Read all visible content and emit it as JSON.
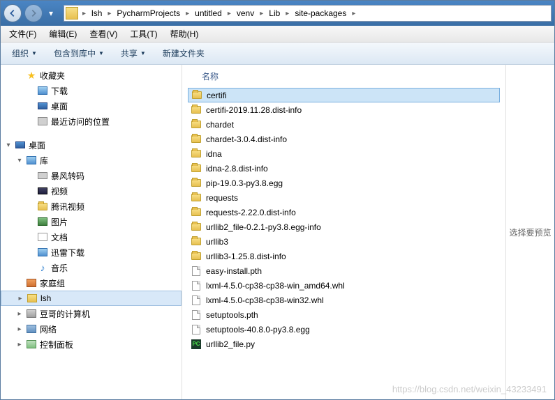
{
  "breadcrumb": [
    "lsh",
    "PycharmProjects",
    "untitled",
    "venv",
    "Lib",
    "site-packages"
  ],
  "menus": [
    {
      "label": "文件(F)"
    },
    {
      "label": "编辑(E)"
    },
    {
      "label": "查看(V)"
    },
    {
      "label": "工具(T)"
    },
    {
      "label": "帮助(H)"
    }
  ],
  "toolbar": [
    {
      "label": "组织",
      "dropdown": true
    },
    {
      "label": "包含到库中",
      "dropdown": true
    },
    {
      "label": "共享",
      "dropdown": true
    },
    {
      "label": "新建文件夹",
      "dropdown": false
    }
  ],
  "tree": [
    {
      "indent": 1,
      "toggle": "",
      "icon": "star",
      "label": "收藏夹"
    },
    {
      "indent": 2,
      "toggle": "",
      "icon": "down",
      "label": "下载"
    },
    {
      "indent": 2,
      "toggle": "",
      "icon": "desktop",
      "label": "桌面"
    },
    {
      "indent": 2,
      "toggle": "",
      "icon": "recent",
      "label": "最近访问的位置"
    },
    {
      "indent": 0,
      "toggle": "",
      "icon": "",
      "label": ""
    },
    {
      "indent": 0,
      "toggle": "▾",
      "icon": "desktop",
      "label": "桌面"
    },
    {
      "indent": 1,
      "toggle": "▾",
      "icon": "lib",
      "label": "库"
    },
    {
      "indent": 2,
      "toggle": "",
      "icon": "drive",
      "label": "暴风转码"
    },
    {
      "indent": 2,
      "toggle": "",
      "icon": "video",
      "label": "视频"
    },
    {
      "indent": 2,
      "toggle": "",
      "icon": "folder",
      "label": "腾讯视频"
    },
    {
      "indent": 2,
      "toggle": "",
      "icon": "pic",
      "label": "图片"
    },
    {
      "indent": 2,
      "toggle": "",
      "icon": "doc",
      "label": "文档"
    },
    {
      "indent": 2,
      "toggle": "",
      "icon": "down",
      "label": "迅雷下载"
    },
    {
      "indent": 2,
      "toggle": "",
      "icon": "music",
      "label": "音乐"
    },
    {
      "indent": 1,
      "toggle": "",
      "icon": "home",
      "label": "家庭组"
    },
    {
      "indent": 1,
      "toggle": "▸",
      "icon": "user",
      "label": "lsh",
      "selected": true
    },
    {
      "indent": 1,
      "toggle": "▸",
      "icon": "comp",
      "label": "豆哥的计算机"
    },
    {
      "indent": 1,
      "toggle": "▸",
      "icon": "net",
      "label": "网络"
    },
    {
      "indent": 1,
      "toggle": "▸",
      "icon": "ctrl",
      "label": "控制面板"
    }
  ],
  "column_header": "名称",
  "files": [
    {
      "icon": "folder",
      "name": "certifi",
      "selected": true
    },
    {
      "icon": "folder",
      "name": "certifi-2019.11.28.dist-info"
    },
    {
      "icon": "folder",
      "name": "chardet"
    },
    {
      "icon": "folder",
      "name": "chardet-3.0.4.dist-info"
    },
    {
      "icon": "folder",
      "name": "idna"
    },
    {
      "icon": "folder",
      "name": "idna-2.8.dist-info"
    },
    {
      "icon": "folder",
      "name": "pip-19.0.3-py3.8.egg"
    },
    {
      "icon": "folder",
      "name": "requests"
    },
    {
      "icon": "folder",
      "name": "requests-2.22.0.dist-info"
    },
    {
      "icon": "folder",
      "name": "urllib2_file-0.2.1-py3.8.egg-info"
    },
    {
      "icon": "folder",
      "name": "urllib3"
    },
    {
      "icon": "folder",
      "name": "urllib3-1.25.8.dist-info"
    },
    {
      "icon": "file",
      "name": "easy-install.pth"
    },
    {
      "icon": "file",
      "name": "lxml-4.5.0-cp38-cp38-win_amd64.whl"
    },
    {
      "icon": "file",
      "name": "lxml-4.5.0-cp38-cp38-win32.whl"
    },
    {
      "icon": "file",
      "name": "setuptools.pth"
    },
    {
      "icon": "file",
      "name": "setuptools-40.8.0-py3.8.egg"
    },
    {
      "icon": "py",
      "name": "urllib2_file.py"
    }
  ],
  "preview_text": "选择要预览",
  "watermark": "https://blog.csdn.net/weixin_43233491"
}
